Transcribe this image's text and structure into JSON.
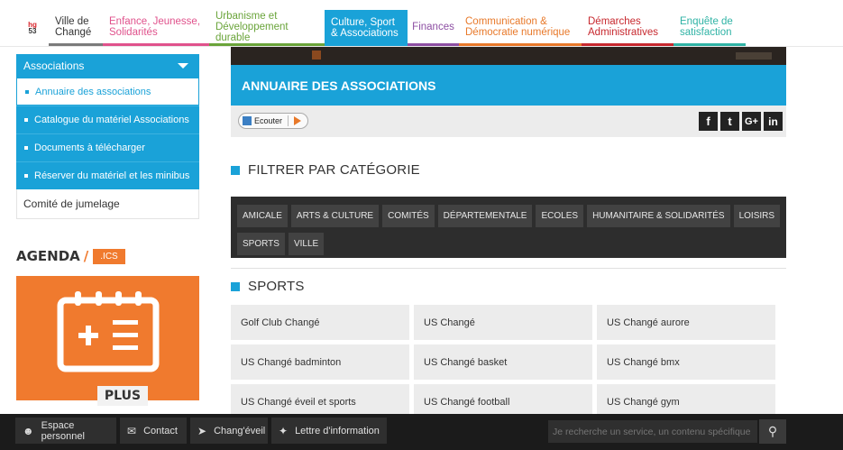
{
  "topnav": {
    "logo_top": "hg",
    "logo_bottom": "53",
    "items": [
      {
        "line1": "Ville de",
        "line2": "Changé"
      },
      {
        "line1": "Enfance, Jeunesse,",
        "line2": "Solidarités"
      },
      {
        "line1": "Urbanisme et",
        "line2": "Développement durable"
      },
      {
        "line1": "Culture, Sport",
        "line2": "& Associations"
      },
      {
        "line1": "Finances",
        "line2": ""
      },
      {
        "line1": "Communication &",
        "line2": "Démocratie numérique"
      },
      {
        "line1": "Démarches",
        "line2": "Administratives"
      },
      {
        "line1": "Enquête de",
        "line2": "satisfaction"
      }
    ]
  },
  "sidebar": {
    "header": "Associations",
    "items": [
      {
        "label": "Annuaire des associations"
      },
      {
        "label": "Catalogue du matériel Associations"
      },
      {
        "label": "Documents à télécharger"
      },
      {
        "label": "Réserver du matériel et les minibus"
      }
    ],
    "jumelage": "Comité de jumelage"
  },
  "agenda": {
    "title": "AGENDA",
    "slash": "/",
    "ics": ".ICS",
    "plus": "PLUS"
  },
  "main": {
    "title": "ANNUAIRE DES ASSOCIATIONS",
    "ecouter": "Ecouter",
    "social": [
      "f",
      "t",
      "G+",
      "in"
    ],
    "filter_title": "FILTRER PAR CATÉGORIE",
    "categories": [
      "AMICALE",
      "ARTS & CULTURE",
      "COMITÉS",
      "DÉPARTEMENTALE",
      "ECOLES",
      "HUMANITAIRE & SOLIDARITÉS",
      "LOISIRS",
      "SPORTS",
      "VILLE"
    ],
    "section_title": "SPORTS",
    "clubs": [
      "Golf Club Changé",
      "US Changé",
      "US Changé aurore",
      "US Changé badminton",
      "US Changé basket",
      "US Changé bmx",
      "US Changé éveil et sports",
      "US Changé football",
      "US Changé gym"
    ]
  },
  "bottombar": {
    "espace": "Espace personnel",
    "contact": "Contact",
    "changeveil": "Chang'éveil",
    "lettre": "Lettre d'information",
    "search_placeholder": "Je recherche un service, un contenu spécifique"
  }
}
